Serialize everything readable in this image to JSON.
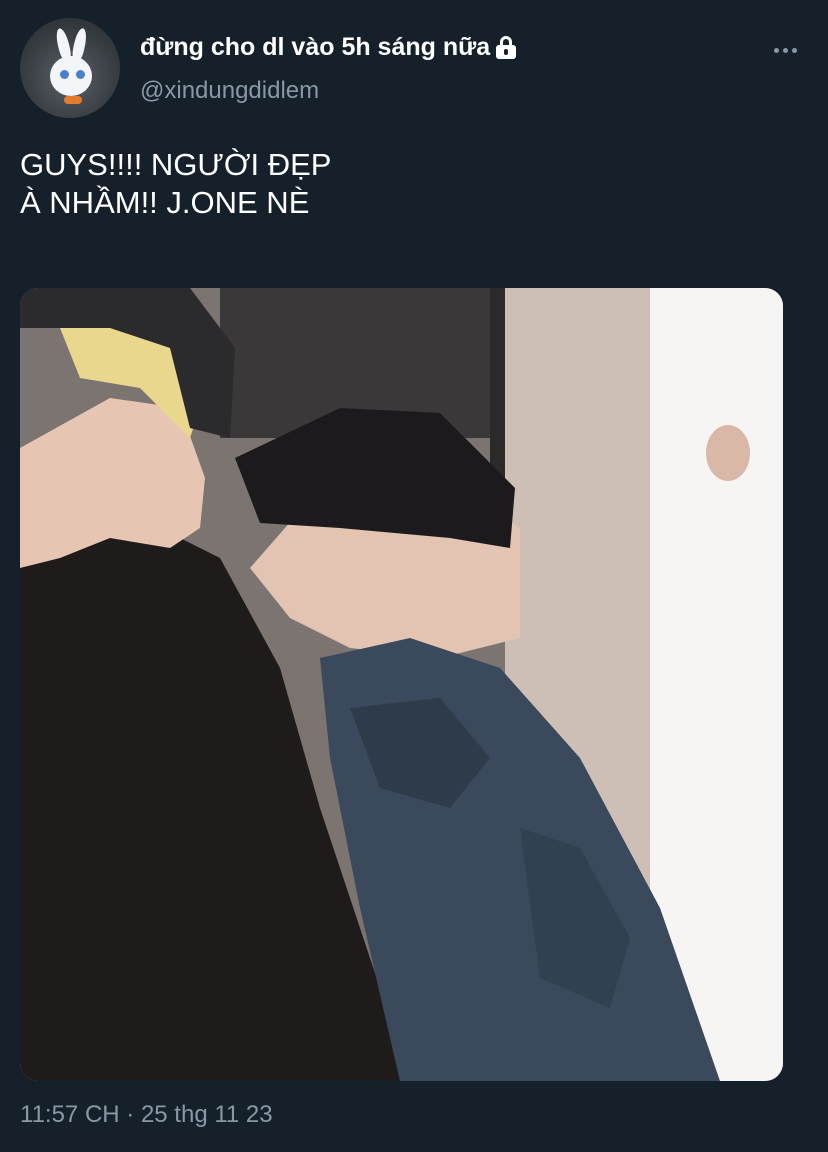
{
  "tweet": {
    "author": {
      "display_name": "đừng cho dl vào 5h sáng nữa",
      "handle": "@xindungdidlem",
      "protected_icon": "lock-icon",
      "avatar": "white bunny character avatar"
    },
    "menu_icon": "more-horizontal-icon",
    "text_lines": [
      "GUYS!!!! NGƯỜI ĐẸP",
      "À NHẦM!! J.ONE NÈ"
    ],
    "media": {
      "type": "photo"
    },
    "timestamp": "11:57 CH · 25 thg 11 23"
  },
  "colors": {
    "background": "#15202b",
    "primary_text": "#ffffff",
    "secondary_text": "#8899a6"
  }
}
